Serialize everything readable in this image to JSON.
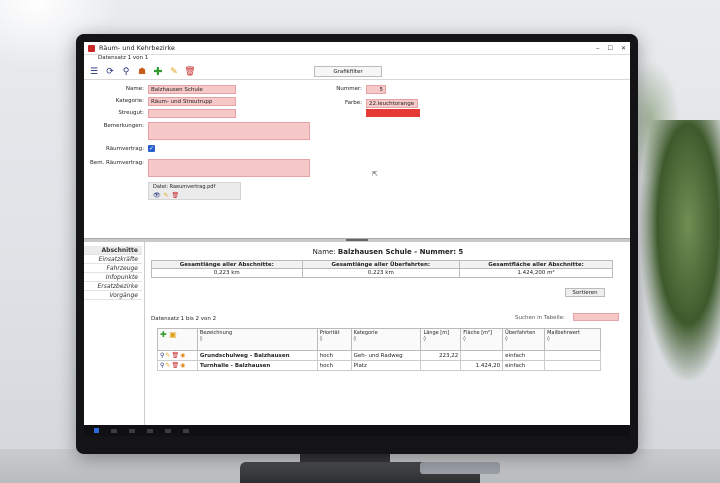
{
  "window": {
    "title": "Räum- und Kehrbezirke",
    "record_info": "Datensatz 1 von 1",
    "controls": [
      "‒",
      "☐",
      "✕"
    ]
  },
  "toolbar": {
    "grafik_button": "Grafikfilter",
    "icons": [
      "menu-icon",
      "sync-icon",
      "search-icon",
      "add-person-icon",
      "plus-icon",
      "pencil-icon",
      "trash-icon"
    ]
  },
  "form": {
    "name_label": "Name:",
    "name_value": "Balzhausen Schule",
    "kategorie_label": "Kategorie:",
    "kategorie_value": "Räum- und Streutrupp",
    "streugut_label": "Streugut:",
    "streugut_value": "",
    "bemerkungen_label": "Bemerkungen:",
    "raeumvertrag_label": "Räumvertrag:",
    "raeumvertrag_checked": true,
    "bem_raeumvertrag_label": "Bem. Räumvertrag:",
    "datei_label": "Datei:",
    "datei_value": "Raeumvertrag.pdf",
    "nummer_label": "Nummer:",
    "nummer_value": "5",
    "farbe_label": "Farbe:",
    "farbe_value": "22.leuchtorange",
    "farbe_color": "#e53935"
  },
  "sidebar": {
    "items": [
      "Abschnitte",
      "Einsatzkräfte",
      "Fahrzeuge",
      "Infopunkte",
      "Ersatzbezirke",
      "Vorgänge"
    ]
  },
  "detail": {
    "heading_prefix": "Name:",
    "heading_value": "Balzhausen Schule - Nummer: 5",
    "summary_headers": [
      "Gesamtlänge aller Abschnitte:",
      "Gesamtlänge aller Überfahrten:",
      "Gesamtfläche aller Abschnitte:"
    ],
    "summary_values": [
      "0,223 km",
      "0,223 km",
      "1.424,200 m²"
    ],
    "sort_button": "Sortieren",
    "record_count": "Datensatz 1 bis 2 von 2",
    "search_label": "Suchen in Tabelle:",
    "grid_headers": [
      {
        "label": "Bezeichnung",
        "sub": "◊"
      },
      {
        "label": "Priorität",
        "sub": "◊"
      },
      {
        "label": "Kategorie",
        "sub": "◊"
      },
      {
        "label": "Länge [m]",
        "sub": "◊"
      },
      {
        "label": "Fläche [m²]",
        "sub": "◊"
      },
      {
        "label": "Überfahrten",
        "sub": "◊"
      },
      {
        "label": "Mailbehrwert",
        "sub": "◊"
      }
    ],
    "rows": [
      {
        "bezeichnung": "Grundschulweg - Balzhausen",
        "prioritaet": "hoch",
        "kategorie": "Geh- und Radweg",
        "laenge": "223,22",
        "flaeche": "",
        "ueberfahrten": "einfach",
        "mail": ""
      },
      {
        "bezeichnung": "Turnhalle - Balzhausen",
        "prioritaet": "hoch",
        "kategorie": "Platz",
        "laenge": "",
        "flaeche": "1.424,20",
        "ueberfahrten": "einfach",
        "mail": ""
      }
    ]
  }
}
